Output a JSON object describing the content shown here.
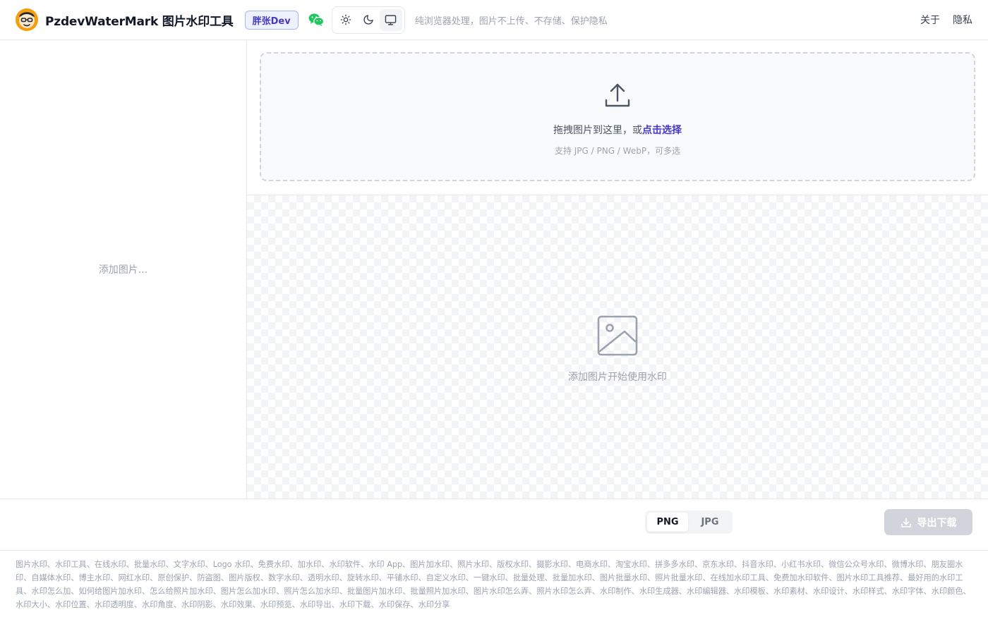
{
  "header": {
    "app_title": "PzdevWaterMark 图片水印工具",
    "badge": "胖张Dev",
    "tagline": "纯浏览器处理，图片不上传、不存储、保护隐私",
    "nav": [
      {
        "label": "关于"
      },
      {
        "label": "隐私"
      }
    ],
    "icons": {
      "logo": "avatar-logo-icon",
      "wechat": "wechat-icon",
      "light": "sun-icon",
      "dark": "moon-icon",
      "system": "monitor-icon"
    },
    "active_theme": "system"
  },
  "sidebar": {
    "placeholder": "添加图片..."
  },
  "upload": {
    "prompt_prefix": "拖拽图片到这里，或",
    "prompt_link": "点击选择",
    "hint": "支持 JPG / PNG / WebP，可多选",
    "icon": "upload-icon"
  },
  "canvas": {
    "empty_text": "添加图片开始使用水印",
    "icon": "image-placeholder-icon"
  },
  "toolbar": {
    "formats": [
      {
        "label": "PNG",
        "active": true
      },
      {
        "label": "JPG",
        "active": false
      }
    ],
    "export_label": "导出下载",
    "export_icon": "download-icon"
  },
  "footer": {
    "keywords": "图片水印、水印工具、在线水印、批量水印、文字水印、Logo 水印、免费水印、加水印、水印软件、水印 App、图片加水印、照片水印、版权水印、摄影水印、电商水印、淘宝水印、拼多多水印、京东水印、抖音水印、小红书水印、微信公众号水印、微博水印、朋友圈水印、自媒体水印、博主水印、网红水印、原创保护、防盗图、图片版权、数字水印、透明水印、旋转水印、平铺水印、自定义水印、一键水印、批量处理、批量加水印、图片批量水印、照片批量水印、在线加水印工具、免费加水印软件、图片水印工具推荐、最好用的水印工具、水印怎么加、如何给图片加水印、怎么给照片加水印、图片怎么加水印、照片怎么加水印、批量图片加水印、批量照片加水印、图片水印怎么弄、照片水印怎么弄、水印制作、水印生成器、水印编辑器、水印模板、水印素材、水印设计、水印样式、水印字体、水印颜色、水印大小、水印位置、水印透明度、水印角度、水印阴影、水印效果、水印预览、水印导出、水印下载、水印保存、水印分享"
  },
  "colors": {
    "accent": "#4338ca",
    "badge_bg": "#eef2ff",
    "wechat": "#22c55e",
    "logo": "#f59e0b",
    "disabled": "#d1d5db"
  }
}
